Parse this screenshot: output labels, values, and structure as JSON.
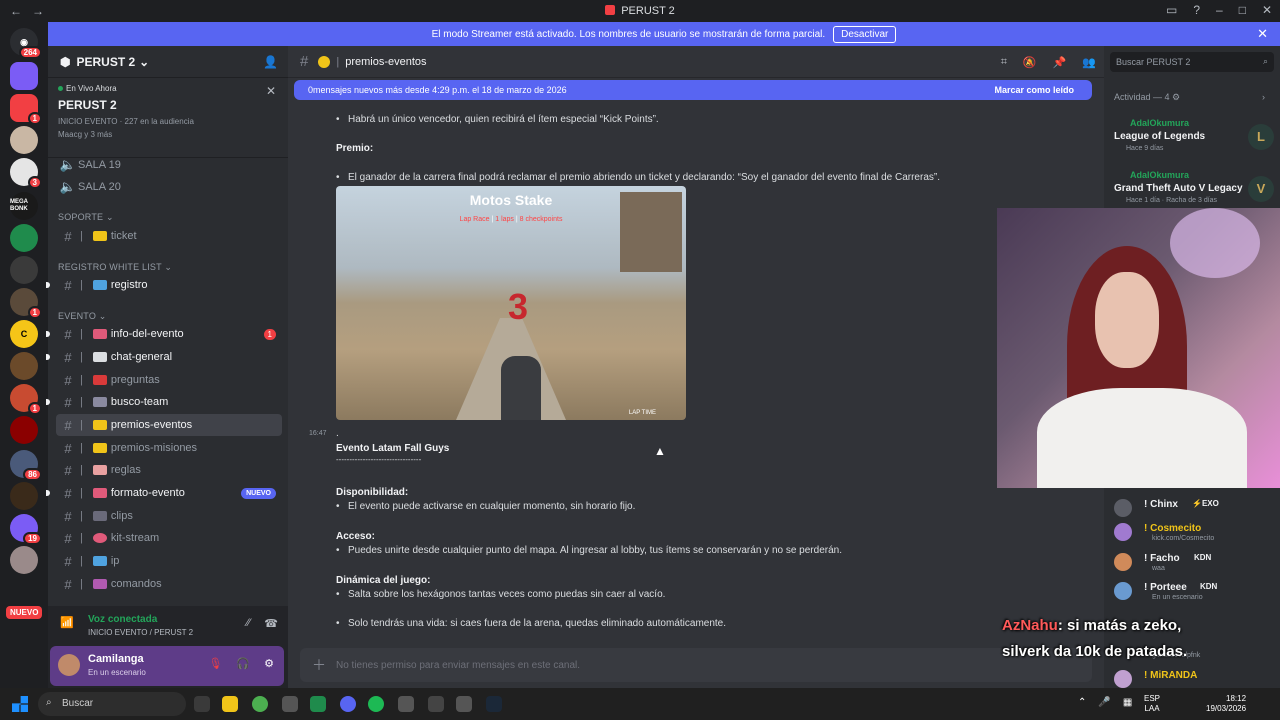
{
  "window": {
    "title": "PERUST 2",
    "nav_back": "←",
    "nav_fwd": "→"
  },
  "banner": {
    "text": "El modo Streamer está activado. Los nombres de usuario se mostrarán de forma parcial.",
    "button": "Desactivar",
    "close": "✕"
  },
  "servers": {
    "home_badge": "264",
    "badges": [
      "1",
      "3",
      "1",
      "1",
      "1",
      "1",
      "86",
      "19"
    ],
    "mega": "MEGA BONK",
    "nuevo": "NUEVO"
  },
  "sidebar": {
    "server_name": "PERUST 2",
    "live": {
      "label": "En Vivo Ahora",
      "name": "PERUST 2",
      "sub": "INICIO EVENTO",
      "audience": "227 en la audiencia",
      "avatars_text": "Maacg y 3 más"
    },
    "channels_top": [
      "SALA 19",
      "SALA 20"
    ],
    "categories": {
      "soporte": "SOPORTE",
      "registro": "REGISTRO WHITE LIST",
      "evento": "EVENTO"
    },
    "channels": {
      "ticket": "ticket",
      "registro": "registro",
      "info": "info-del-evento",
      "info_count": "1",
      "chat": "chat-general",
      "preguntas": "preguntas",
      "busco": "busco-team",
      "premios": "premios-eventos",
      "misiones": "premios-misiones",
      "reglas": "reglas",
      "formato": "formato-evento",
      "formato_new": "NUEVO",
      "clips": "clips",
      "kit": "kit-stream",
      "ip": "ip",
      "comandos": "comandos"
    },
    "voice": {
      "status": "Voz conectada",
      "location": "INICIO EVENTO / PERUST 2"
    },
    "user": {
      "name": "Camilanga",
      "status": "En un escenario"
    }
  },
  "channel": {
    "name": "premios-eventos",
    "new_messages": "0mensajes nuevos más desde 4:29 p.m. el 18 de marzo de 2026",
    "mark_read": "Marcar como leído",
    "composer": "No tienes permiso para enviar mensajes en este canal."
  },
  "messages": {
    "l1": "Habrá un único vencedor, quien recibirá el ítem especial “Kick Points”.",
    "premio": "Premio:",
    "l2": "El ganador de la carrera final podrá reclamar el premio abriendo un ticket y declarando: “Soy el ganador del evento final de Carreras”.",
    "img_title": "Motos Stake",
    "img_sub_a": "Lap Race",
    "img_sub_b": "1 laps",
    "img_sub_c": "8 checkpoints",
    "img_num": "3",
    "img_lap": "LAP TIME",
    "ts": "16:47",
    "dot": ".",
    "heading": "Evento Latam Fall Guys",
    "rule": "--------------------------------",
    "disp": "Disponibilidad:",
    "disp_text": "El evento puede activarse en cualquier momento, sin horario fijo.",
    "acceso": "Acceso:",
    "acceso_text": "Puedes unirte desde cualquier punto del mapa. Al ingresar al lobby, tus ítems se conservarán y no se perderán.",
    "dinamica": "Dinámica del juego:",
    "din_text": "Salta sobre los hexágonos tantas veces como puedas sin caer al vacío.",
    "vida_text": "Solo tendrás una vida: si caes fuera de la arena, quedas eliminado automáticamente.",
    "bullet": "•"
  },
  "right": {
    "search": "Buscar PERUST 2",
    "activity": "Actividad — 4",
    "act": [
      {
        "user": "AdalOkumura",
        "game": "League of Legends",
        "time": "Hace 9 días",
        "icon": "L"
      },
      {
        "user": "AdalOkumura",
        "game": "Grand Theft Auto V Legacy",
        "time": "Hace 1 día  ·  Racha de 3 días",
        "icon": "V"
      }
    ]
  },
  "chat": [
    {
      "name": "! Chinx",
      "tag": "⚡EXO",
      "sub": ""
    },
    {
      "name": "! Cosmecito",
      "tag": "",
      "sub": "kick.com/Cosmecito"
    },
    {
      "name": "! Facho",
      "tag": "KDN",
      "sub": "waa"
    },
    {
      "name": "! Porteee",
      "tag": "KDN",
      "sub": "En un escenario"
    },
    {
      "name": "",
      "tag": "",
      "sub": "guns.lol/valpfnk"
    },
    {
      "name": "! MiRANDA",
      "tag": "",
      "sub": ""
    }
  ],
  "overlay": {
    "user": "AzNahu",
    "line1": ": si matás a zeko,",
    "line2": "silverk da 10k de patadas."
  },
  "taskbar": {
    "search": "Buscar",
    "lang1": "ESP",
    "lang2": "LAA",
    "time": "18:12",
    "date": "19/03/2026"
  }
}
